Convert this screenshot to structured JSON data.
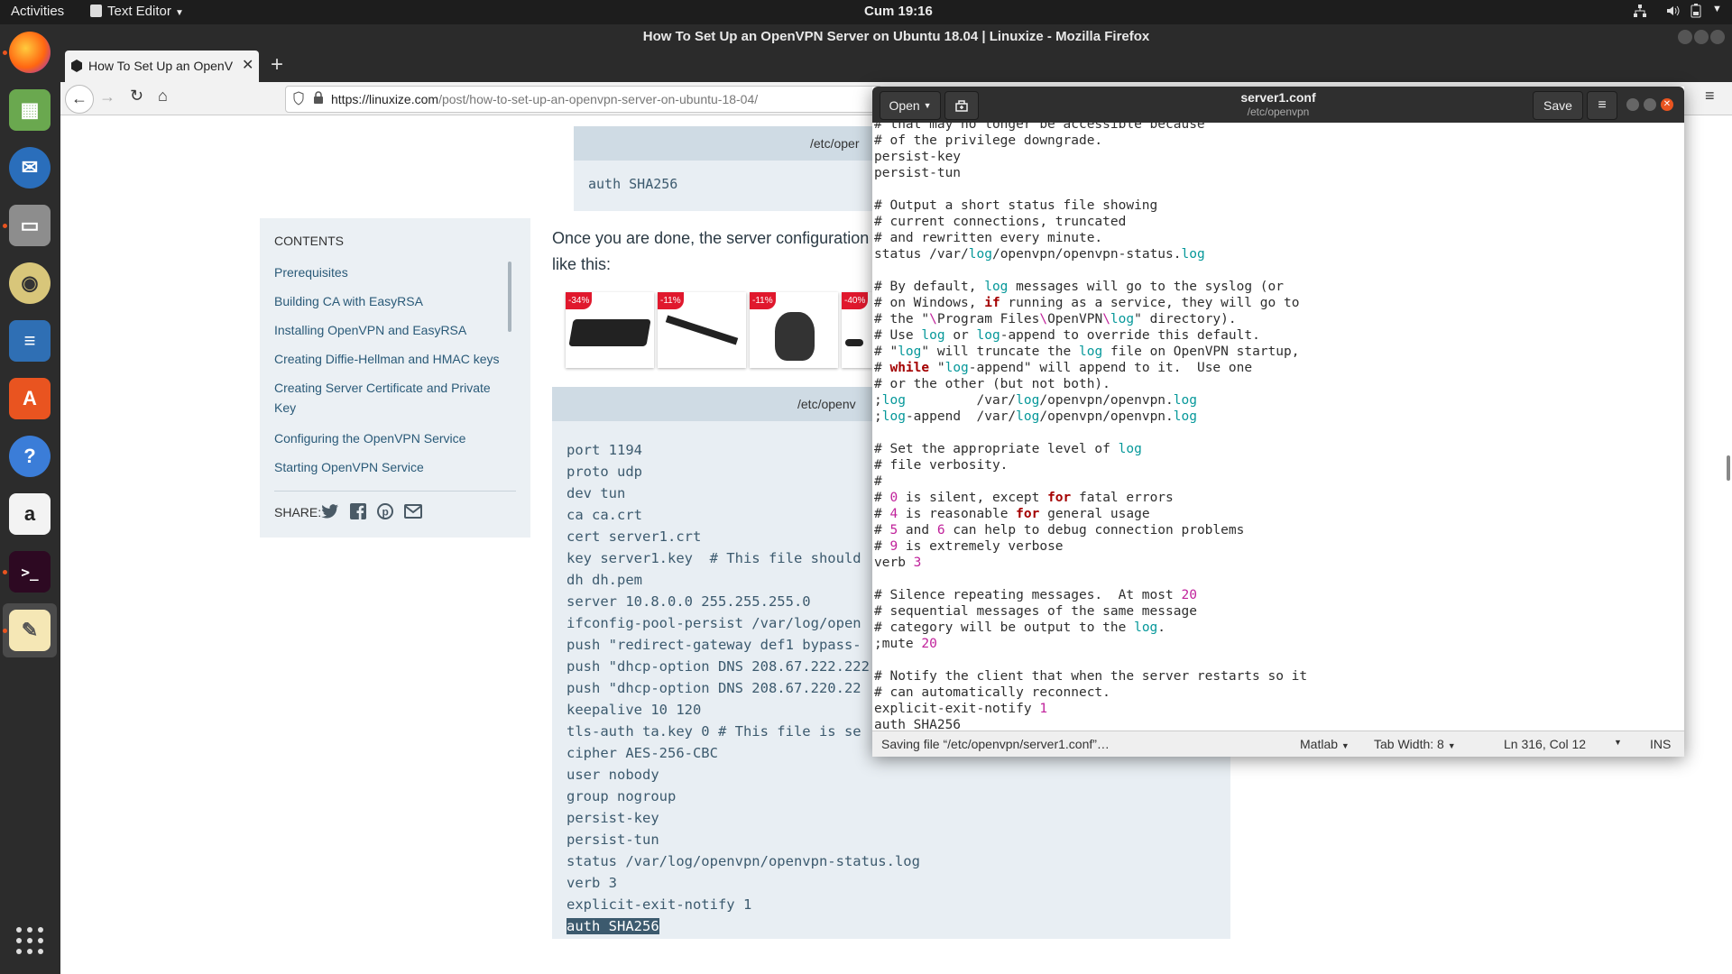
{
  "topbar": {
    "activities": "Activities",
    "app_menu": "Text Editor",
    "clock": "Cum 19:16"
  },
  "firefox": {
    "window_title": "How To Set Up an OpenVPN Server on Ubuntu 18.04 | Linuxize - Mozilla Firefox",
    "tab_title": "How To Set Up an OpenV",
    "url_domain": "https://linuxize.com",
    "url_path": "/post/how-to-set-up-an-openvpn-server-on-ubuntu-18-04/"
  },
  "page": {
    "top_code_header": "/etc/oper",
    "top_code_text": "auth SHA256",
    "toc": {
      "heading": "CONTENTS",
      "items": [
        "Prerequisites",
        "Building CA with EasyRSA",
        "Installing OpenVPN and EasyRSA",
        "Creating Diffie-Hellman and HMAC keys",
        "Creating Server Certificate and Private Key",
        "Configuring the OpenVPN Service",
        "Starting OpenVPN Service"
      ],
      "share_label": "SHARE:"
    },
    "paragraph_line1": "Once you are done, the server configuration f",
    "paragraph_line2": "like this:",
    "ads": [
      "-34%",
      "-11%",
      "-11%",
      "-40%"
    ],
    "code_header": "/etc/openv",
    "code_lines": [
      "port 1194",
      "proto udp",
      "dev tun",
      "ca ca.crt",
      "cert server1.crt",
      "key server1.key  # This file should",
      "dh dh.pem",
      "server 10.8.0.0 255.255.255.0",
      "ifconfig-pool-persist /var/log/open",
      "push \"redirect-gateway def1 bypass-",
      "push \"dhcp-option DNS 208.67.222.222",
      "push \"dhcp-option DNS 208.67.220.22",
      "keepalive 10 120",
      "tls-auth ta.key 0 # This file is se",
      "cipher AES-256-CBC",
      "user nobody",
      "group nogroup",
      "persist-key",
      "persist-tun",
      "status /var/log/openvpn/openvpn-status.log",
      "verb 3",
      "explicit-exit-notify 1"
    ],
    "code_selected_line": "auth SHA256"
  },
  "gedit": {
    "open_label": "Open",
    "filename": "server1.conf",
    "path": "/etc/openvpn",
    "save_label": "Save",
    "status_message": "Saving file “/etc/openvpn/server1.conf”…",
    "language": "Matlab",
    "tab_width": "Tab Width: 8",
    "position": "Ln 316, Col 12",
    "mode": "INS"
  },
  "colors": {
    "accent": "#e95420",
    "keyword": "#a40000",
    "log_word": "#06989a",
    "number": "#c0229b"
  }
}
